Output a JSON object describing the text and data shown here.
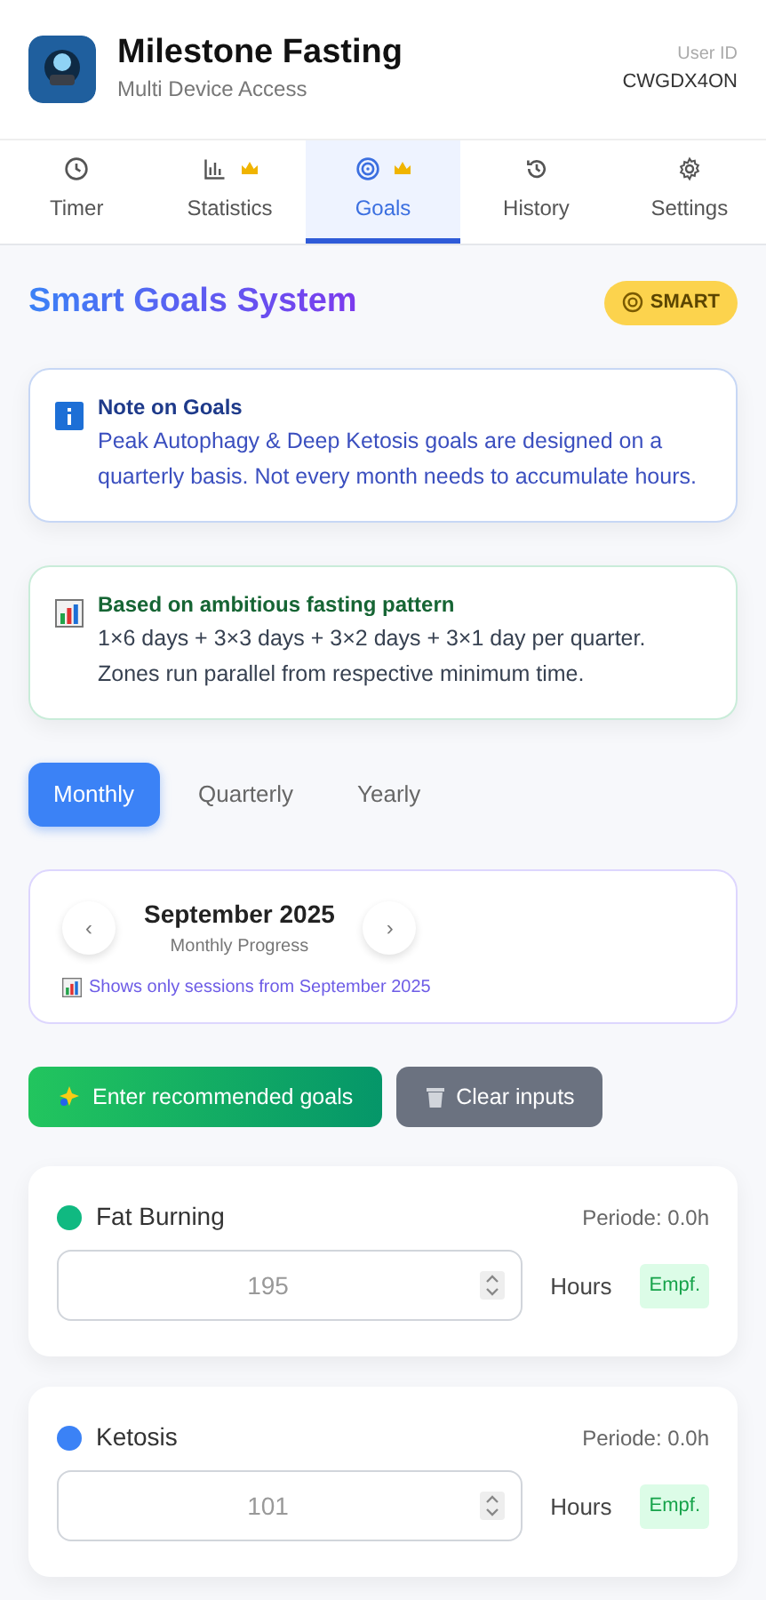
{
  "header": {
    "title": "Milestone Fasting",
    "subtitle": "Multi Device Access",
    "user_id_label": "User ID",
    "user_id": "CWGDX4ON"
  },
  "tabs": [
    {
      "label": "Timer",
      "premium": false,
      "selected": false
    },
    {
      "label": "Statistics",
      "premium": true,
      "selected": false
    },
    {
      "label": "Goals",
      "premium": true,
      "selected": true
    },
    {
      "label": "History",
      "premium": false,
      "selected": false
    },
    {
      "label": "Settings",
      "premium": false,
      "selected": false
    }
  ],
  "section": {
    "title": "Smart Goals System",
    "badge": "SMART"
  },
  "notes": [
    {
      "kind": "info",
      "title": "Note on Goals",
      "text": "Peak Autophagy & Deep Ketosis goals are designed on a quarterly basis. Not every month needs to accumulate hours."
    },
    {
      "kind": "pattern",
      "title": "Based on ambitious fasting pattern",
      "text": "1×6 days + 3×3 days + 3×2 days + 3×1 day per quarter. Zones run parallel from respective minimum time."
    }
  ],
  "periods": [
    {
      "label": "Monthly",
      "selected": true
    },
    {
      "label": "Quarterly",
      "selected": false
    },
    {
      "label": "Yearly",
      "selected": false
    }
  ],
  "period_nav": {
    "prev": "‹",
    "title": "September 2025",
    "subtitle": "Monthly Progress",
    "next": "›",
    "hint": "Shows only sessions from September 2025"
  },
  "actions": [
    {
      "kind": "recommend",
      "label": "Enter recommended goals"
    },
    {
      "kind": "clear",
      "label": "Clear inputs"
    }
  ],
  "zones": [
    {
      "name": "Fat Burning",
      "color": "#10b981",
      "period": "Periode: 0.0h",
      "value": "195",
      "unit": "Hours",
      "recommend": "Empf."
    },
    {
      "name": "Ketosis",
      "color": "#3b82f6",
      "period": "Periode: 0.0h",
      "value": "101",
      "unit": "Hours",
      "recommend": "Empf."
    }
  ]
}
